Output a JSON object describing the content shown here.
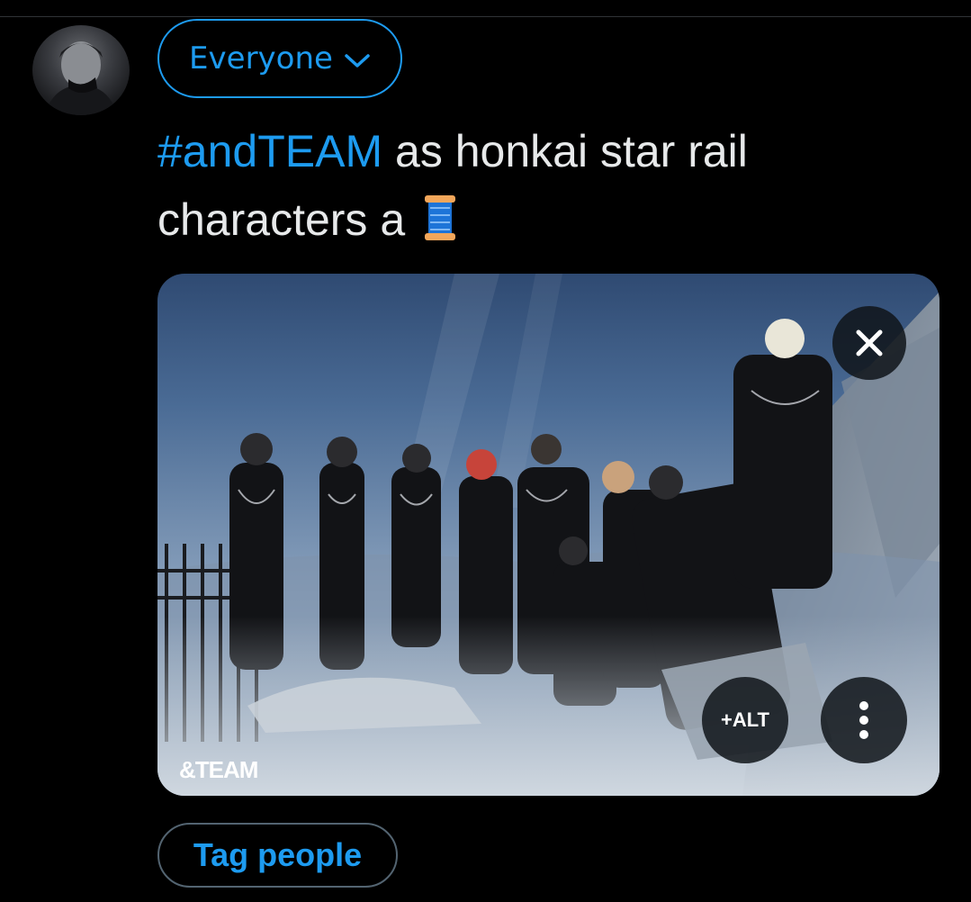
{
  "composer": {
    "audience_label": "Everyone",
    "audience_icon": "chevron-down-icon",
    "hashtag": "#andTEAM",
    "text_rest": " as honkai star rail characters a",
    "emoji": "spool-of-thread"
  },
  "media": {
    "watermark": "&TEAM",
    "alt_label": "+ALT",
    "close_icon": "close-icon",
    "more_icon": "more-vertical-icon"
  },
  "actions": {
    "tag_people_label": "Tag people"
  },
  "colors": {
    "accent": "#1d9bf0",
    "background": "#000000",
    "text": "#e7e9ea",
    "border": "#536471"
  }
}
